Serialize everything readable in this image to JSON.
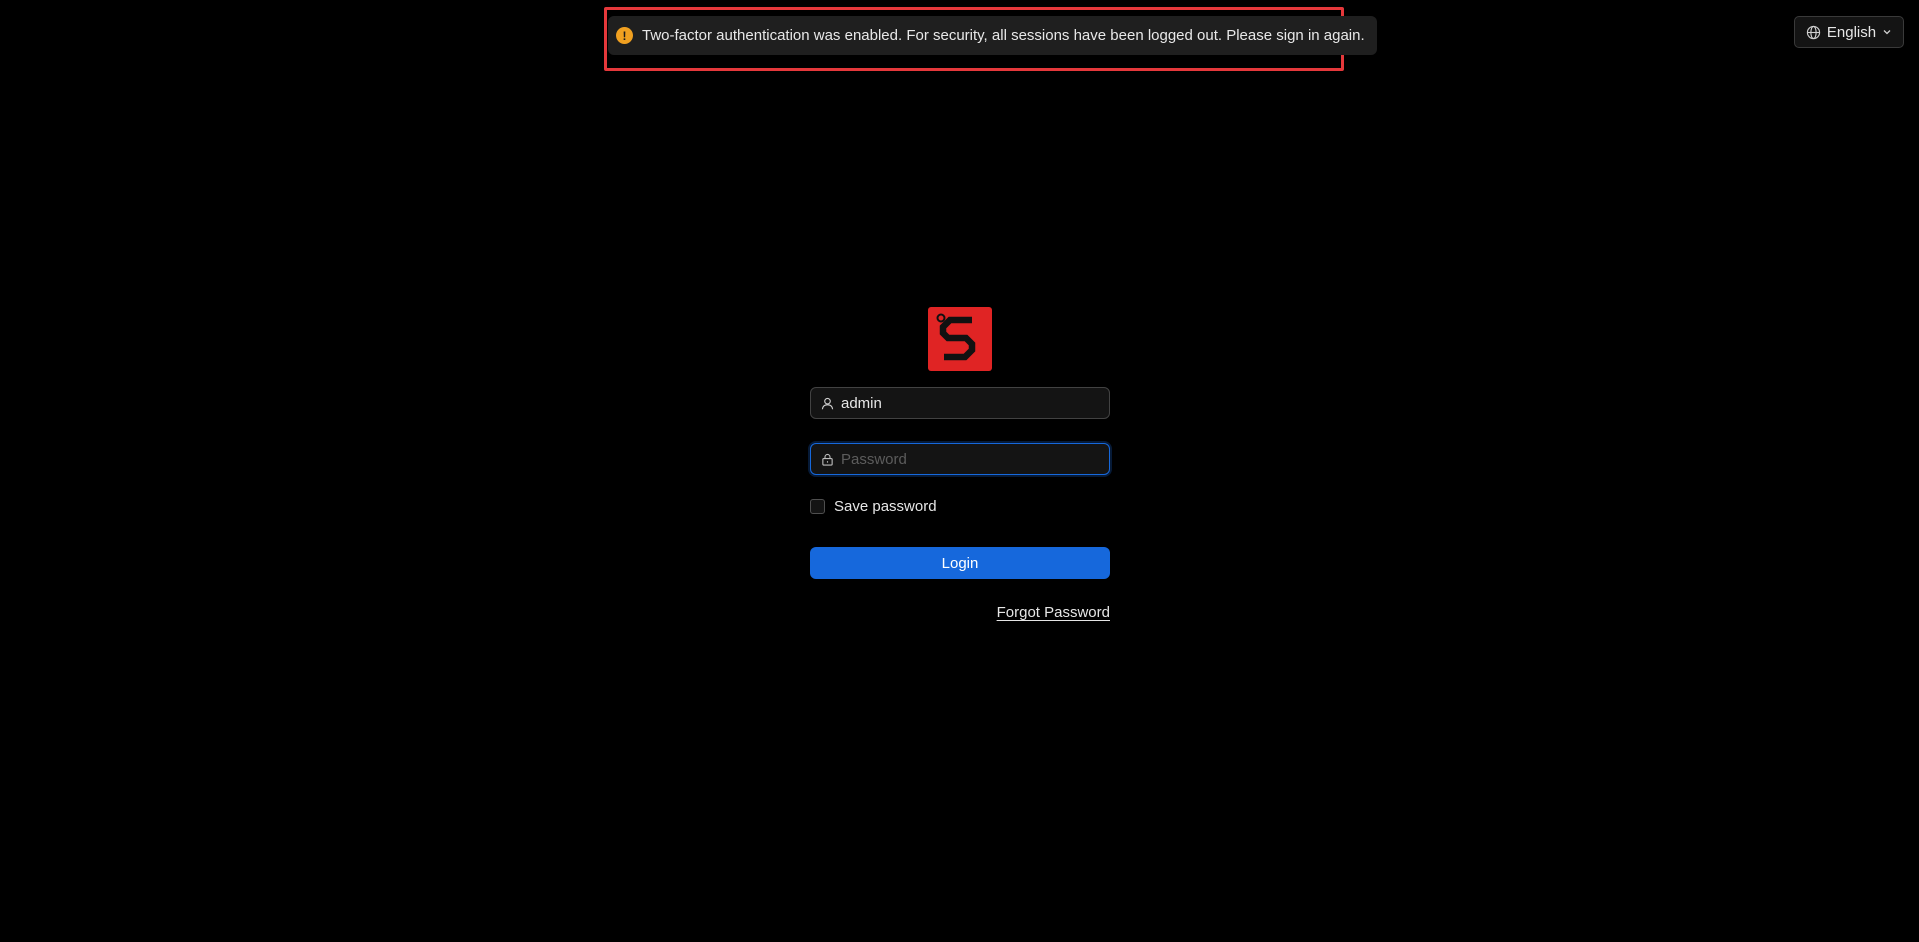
{
  "notification": {
    "icon": "warning-icon",
    "message": "Two-factor authentication was enabled. For security, all sessions have been logged out. Please sign in again."
  },
  "language": {
    "icon": "globe-icon",
    "selected": "English"
  },
  "login": {
    "logo_icon": "app-logo",
    "username_icon": "user-icon",
    "username_value": "admin",
    "password_icon": "lock-icon",
    "password_placeholder": "Password",
    "save_password_label": "Save password",
    "save_password_checked": false,
    "login_button_label": "Login",
    "forgot_password_label": "Forgot Password"
  },
  "colors": {
    "background": "#000000",
    "accent": "#1668dc",
    "brand": "#e02424",
    "highlight": "#e5383b",
    "warning": "#f0a020"
  }
}
